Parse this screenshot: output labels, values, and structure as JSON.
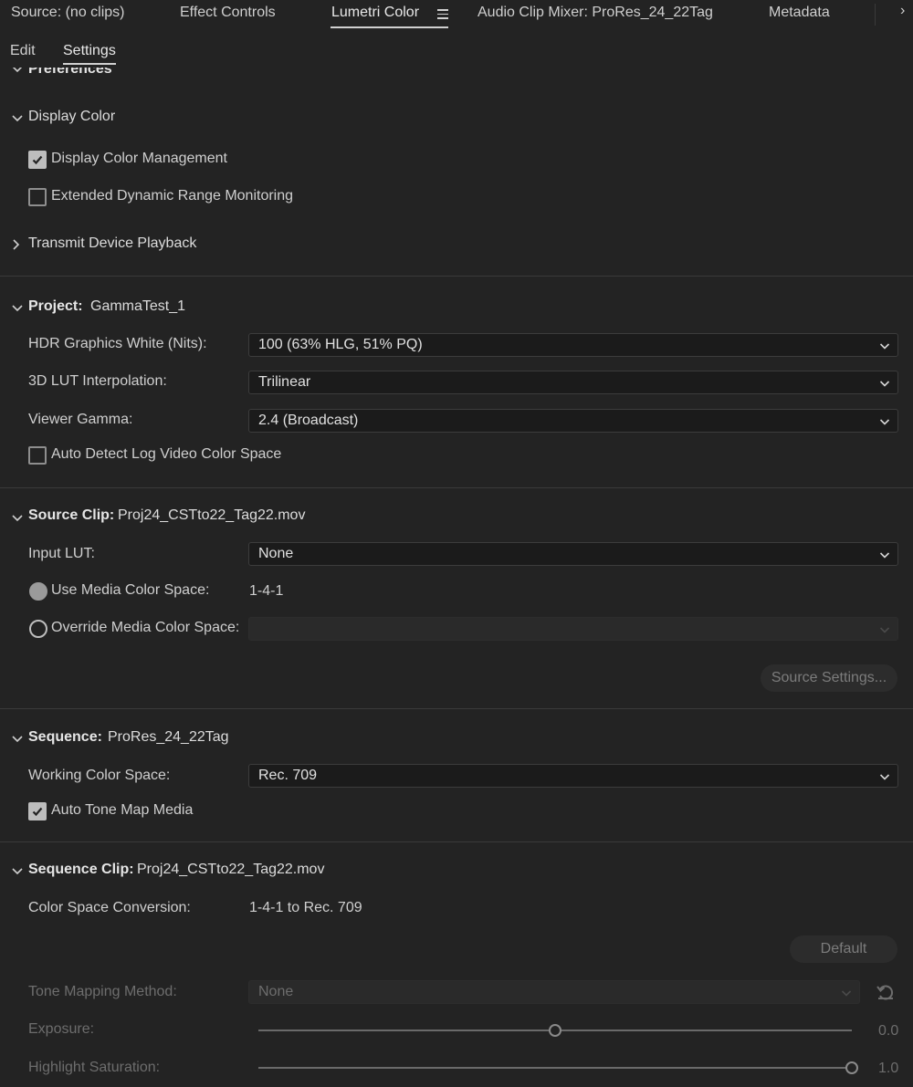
{
  "tabs": {
    "source": "Source: (no clips)",
    "effect_controls": "Effect Controls",
    "lumetri_color": "Lumetri Color",
    "audio_mixer": "Audio Clip Mixer: ProRes_24_22Tag",
    "metadata": "Metadata"
  },
  "subtabs": {
    "edit": "Edit",
    "settings": "Settings"
  },
  "preferences_partial": "Preferences",
  "display_color": {
    "title": "Display Color",
    "display_color_management": {
      "label": "Display Color Management",
      "checked": true
    },
    "edr_monitoring": {
      "label": "Extended Dynamic Range Monitoring",
      "checked": false
    },
    "transmit_playback": "Transmit Device Playback"
  },
  "project": {
    "title_bold": "Project:",
    "title_value": "GammaTest_1",
    "hdr_white_label": "HDR Graphics White (Nits):",
    "hdr_white_value": "100 (63% HLG, 51% PQ)",
    "lut_interp_label": "3D LUT Interpolation:",
    "lut_interp_value": "Trilinear",
    "viewer_gamma_label": "Viewer Gamma:",
    "viewer_gamma_value": "2.4 (Broadcast)",
    "auto_detect_log": {
      "label": "Auto Detect Log Video Color Space",
      "checked": false
    }
  },
  "source_clip": {
    "title_bold": "Source Clip:",
    "title_value": "Proj24_CSTto22_Tag22.mov",
    "input_lut_label": "Input LUT:",
    "input_lut_value": "None",
    "use_media_label": "Use Media Color Space:",
    "use_media_value": "1-4-1",
    "override_label": "Override Media Color Space:",
    "override_value": "",
    "source_settings_button": "Source Settings..."
  },
  "sequence": {
    "title_bold": "Sequence:",
    "title_value": "ProRes_24_22Tag",
    "working_space_label": "Working Color Space:",
    "working_space_value": "Rec. 709",
    "auto_tone_map": {
      "label": "Auto Tone Map Media",
      "checked": true
    }
  },
  "sequence_clip": {
    "title_bold": "Sequence Clip:",
    "title_value": "Proj24_CSTto22_Tag22.mov",
    "csc_label": "Color Space Conversion:",
    "csc_value": "1-4-1 to Rec. 709",
    "default_button": "Default",
    "tone_mapping_label": "Tone Mapping Method:",
    "tone_mapping_value": "None",
    "exposure_label": "Exposure:",
    "exposure_value": "0.0",
    "exposure_fraction": 0.5,
    "highlight_sat_label": "Highlight Saturation:",
    "highlight_sat_value": "1.0",
    "highlight_sat_fraction": 1.0
  }
}
